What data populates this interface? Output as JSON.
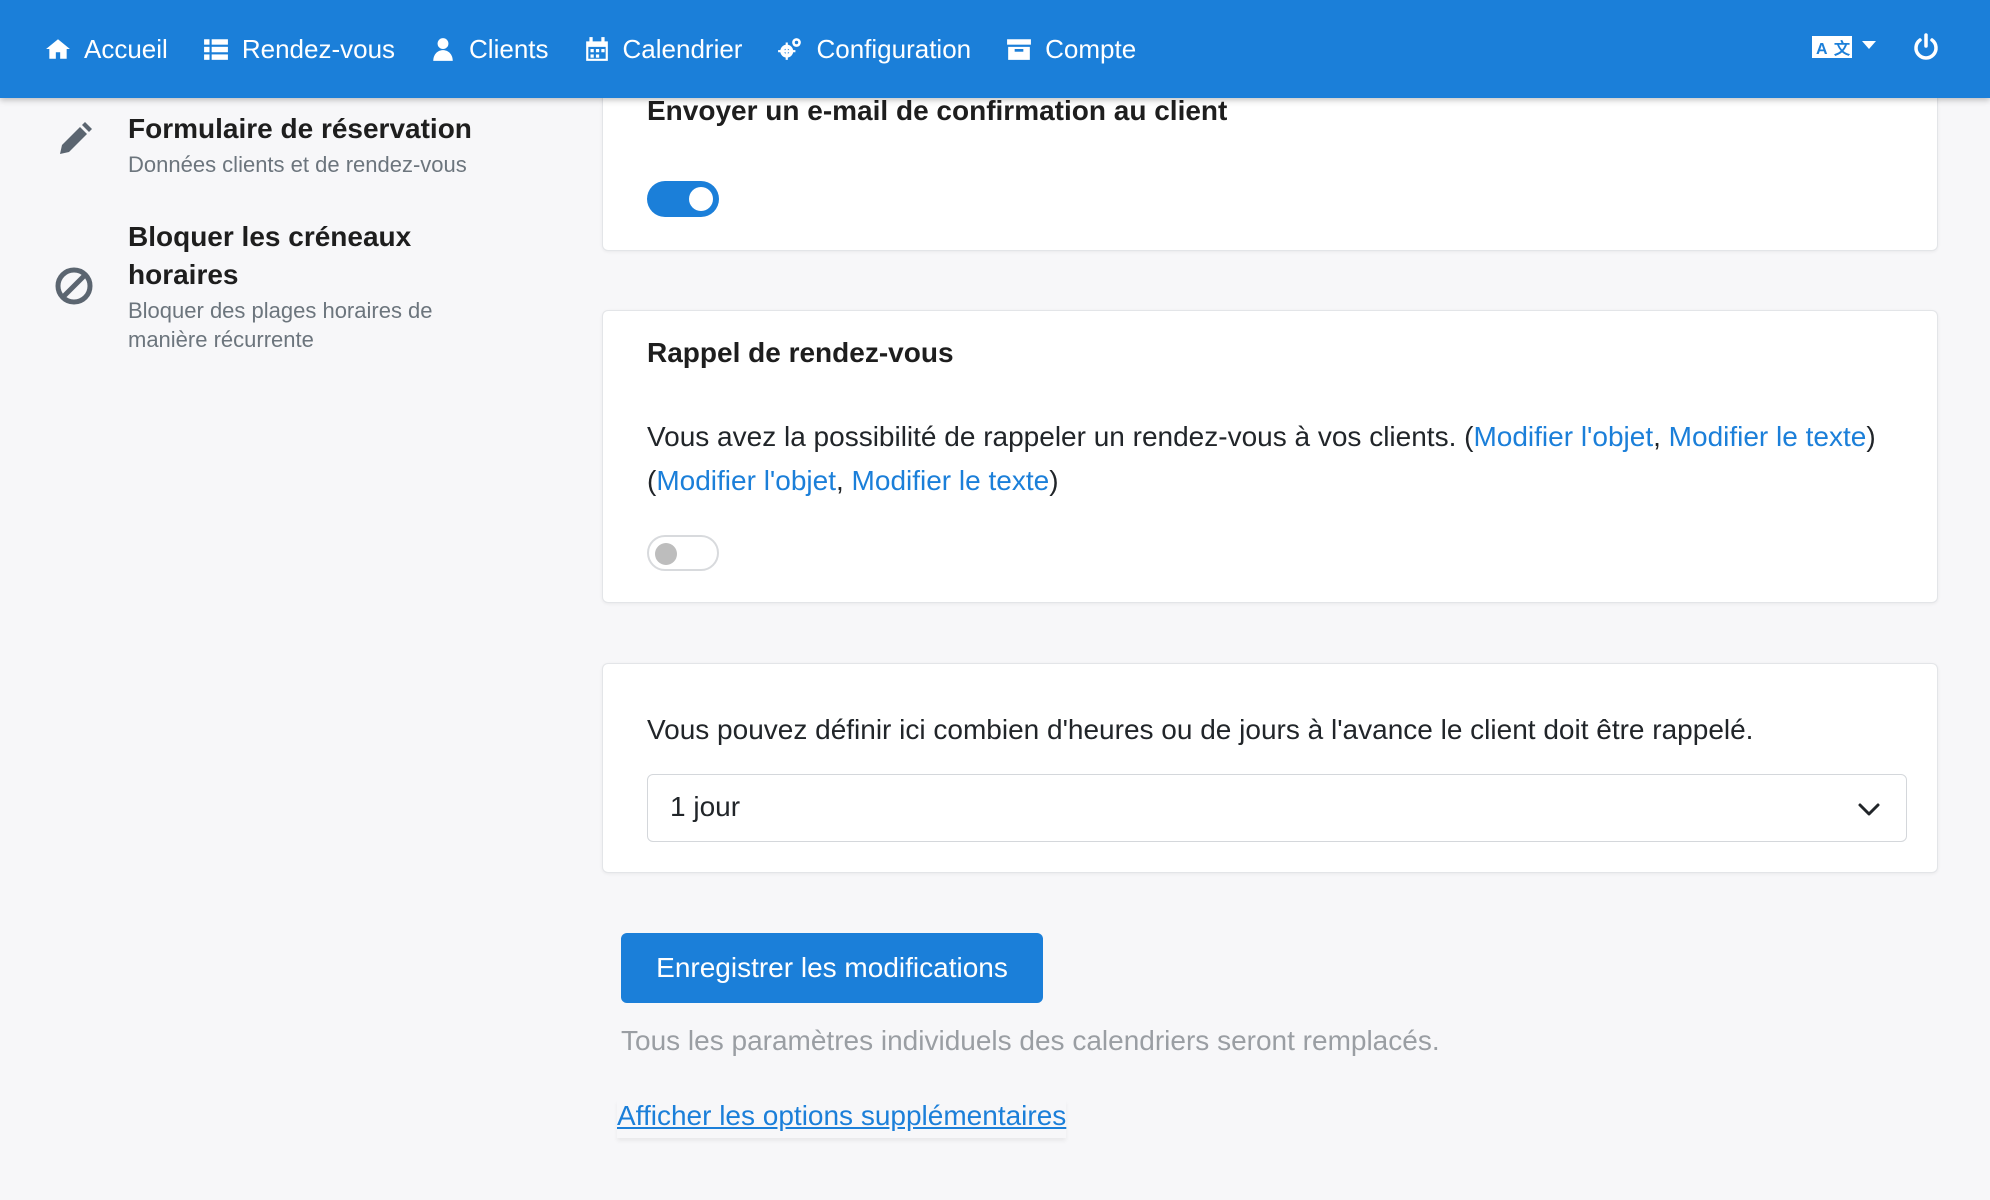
{
  "navbar": {
    "items": [
      {
        "label": "Accueil",
        "icon": "home-icon"
      },
      {
        "label": "Rendez-vous",
        "icon": "list-icon"
      },
      {
        "label": "Clients",
        "icon": "user-icon"
      },
      {
        "label": "Calendrier",
        "icon": "calendar-icon"
      },
      {
        "label": "Configuration",
        "icon": "cogs-icon"
      },
      {
        "label": "Compte",
        "icon": "archive-icon"
      }
    ],
    "language_icon": "language-icon",
    "power_icon": "power-icon",
    "bg_color": "#1b7fd9"
  },
  "sidebar": {
    "items": [
      {
        "title": "Formulaire de réservation",
        "subtitle": "Données clients et de rendez-vous",
        "icon": "pencil-icon"
      },
      {
        "title": "Bloquer les créneaux horaires",
        "subtitle": "Bloquer des plages horaires de manière récurrente",
        "icon": "ban-icon"
      }
    ]
  },
  "confirmation_card": {
    "title": "Envoyer un e-mail de confirmation au client",
    "toggle_on": true
  },
  "reminder_card": {
    "title": "Rappel de rendez-vous",
    "text_before": "Vous avez la possibilité de rappeler un rendez-vous à vos clients. (",
    "link_edit_subject": "Modifier l'objet",
    "separator": ", ",
    "link_edit_text": "Modifier le texte",
    "text_middle": ") (",
    "text_after": ")",
    "toggle_on": false
  },
  "advance_card": {
    "text": "Vous pouvez définir ici combien d'heures ou de jours à l'avance le client doit être rappelé.",
    "select_value": "1 jour"
  },
  "actions": {
    "save_label": "Enregistrer les modifications",
    "note": "Tous les paramètres individuels des calendriers seront remplacés.",
    "more_options_link": "Afficher les options supplémentaires"
  }
}
